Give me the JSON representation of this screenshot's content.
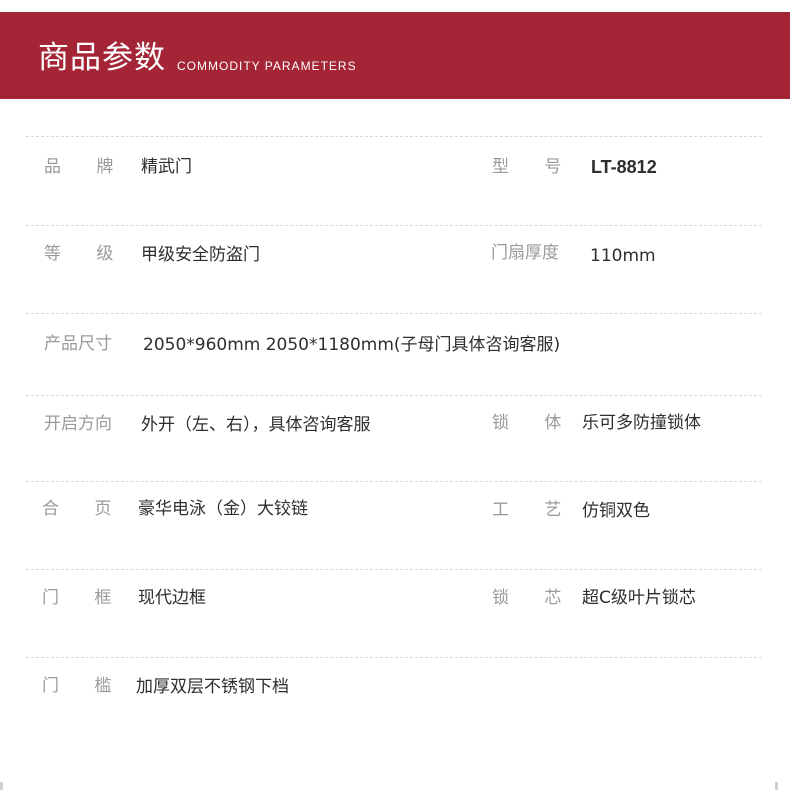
{
  "header": {
    "title": "商品参数",
    "subtitle": "COMMODITY PARAMETERS"
  },
  "params": {
    "brand_label": "品 牌",
    "brand_value": "精武门",
    "model_label": "型 号",
    "model_value": "LT-8812",
    "grade_label": "等 级",
    "grade_value": "甲级安全防盗门",
    "thickness_label": "门扇厚度",
    "thickness_value": "110mm",
    "size_label": "产品尺寸",
    "size_value": "2050*960mm  2050*1180mm(子母门具体咨询客服)",
    "opening_label": "开启方向",
    "opening_value": "外开（左、右），具体咨询客服",
    "lock_body_label": "锁 体",
    "lock_body_value": "乐可多防撞锁体",
    "hinge_label": "合 页",
    "hinge_value": "豪华电泳（金）大铰链",
    "craft_label": "工 艺",
    "craft_value": "仿铜双色",
    "frame_label": "门 框",
    "frame_value": "现代边框",
    "lock_core_label": "锁 芯",
    "lock_core_value": "超C级叶片锁芯",
    "sill_label": "门 槛",
    "sill_value": "加厚双层不锈钢下档"
  },
  "colors": {
    "header_bg": "#a32536",
    "label": "#9a9a9a",
    "value": "#2e2e2e"
  }
}
